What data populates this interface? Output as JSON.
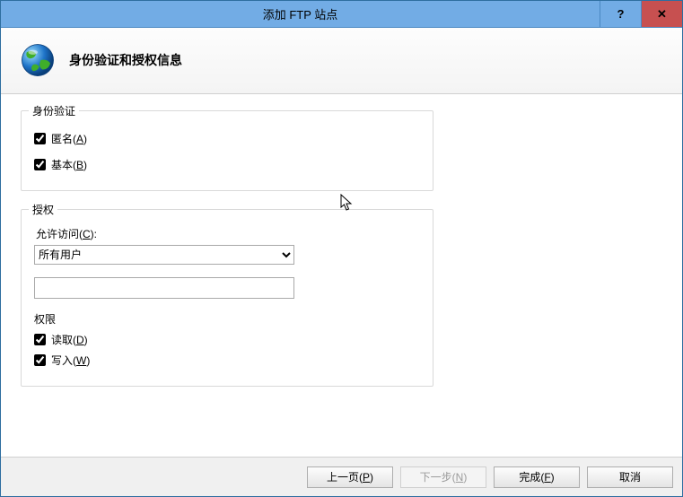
{
  "window": {
    "title": "添加 FTP 站点"
  },
  "header": {
    "title": "身份验证和授权信息"
  },
  "auth": {
    "legend": "身份验证",
    "anonymous_label": "匿名(A)",
    "anonymous_hotkey": "A",
    "basic_label": "基本(B)",
    "basic_hotkey": "B"
  },
  "authorization": {
    "legend": "授权",
    "allow_access_label": "允许访问(C):",
    "allow_access_value": "所有用户",
    "specific_value": "",
    "permissions_label": "权限",
    "read_label": "读取(D)",
    "write_label": "写入(W)"
  },
  "buttons": {
    "prev": "上一页(P)",
    "next": "下一步(N)",
    "finish": "完成(F)",
    "cancel": "取消"
  }
}
